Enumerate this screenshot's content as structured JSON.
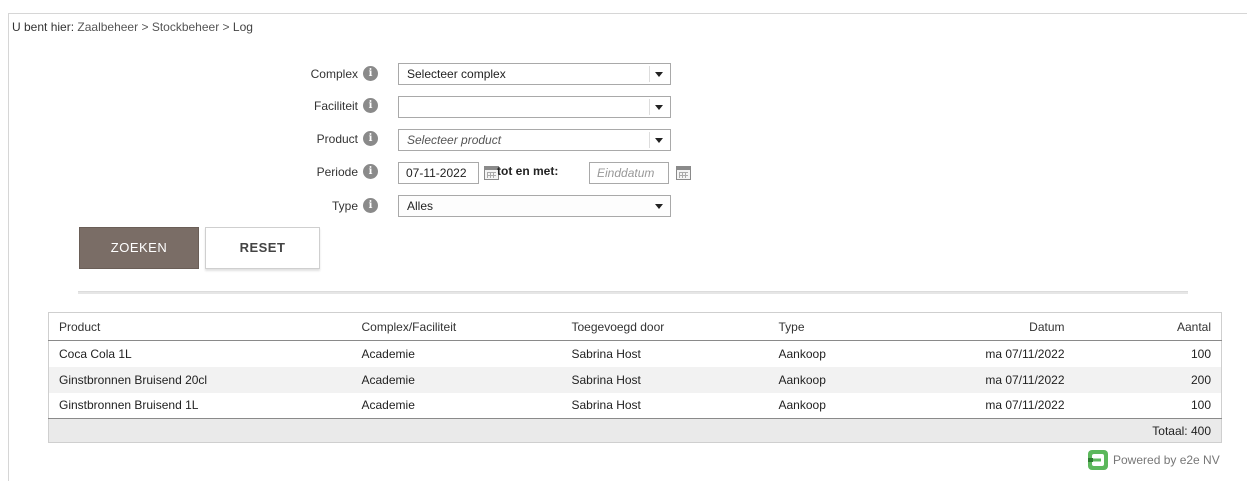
{
  "breadcrumb": {
    "prefix": "U bent hier:",
    "items": [
      "Zaalbeheer",
      "Stockbeheer",
      "Log"
    ],
    "separator": ">"
  },
  "filters": {
    "complex": {
      "label": "Complex",
      "value": "Selecteer complex"
    },
    "faciliteit": {
      "label": "Faciliteit",
      "value": ""
    },
    "product": {
      "label": "Product",
      "value": "Selecteer product"
    },
    "periode": {
      "label": "Periode",
      "start": "07-11-2022",
      "to_label": "tot en met:",
      "end_placeholder": "Einddatum"
    },
    "type": {
      "label": "Type",
      "value": "Alles"
    },
    "info_glyph": "i"
  },
  "buttons": {
    "search": "ZOEKEN",
    "reset": "RESET"
  },
  "table": {
    "headers": [
      "Product",
      "Complex/Faciliteit",
      "Toegevoegd door",
      "Type",
      "Datum",
      "Aantal"
    ],
    "rows": [
      [
        "Coca Cola 1L",
        "Academie",
        "Sabrina Host",
        "Aankoop",
        "ma 07/11/2022",
        "100"
      ],
      [
        "Ginstbronnen Bruisend 20cl",
        "Academie",
        "Sabrina Host",
        "Aankoop",
        "ma 07/11/2022",
        "200"
      ],
      [
        "Ginstbronnen Bruisend 1L",
        "Academie",
        "Sabrina Host",
        "Aankoop",
        "ma 07/11/2022",
        "100"
      ]
    ],
    "total": "Totaal: 400"
  },
  "footer": {
    "powered_by": "Powered by e2e NV"
  },
  "colors": {
    "search_button": "#7a6d66",
    "logo_green": "#5cb85c",
    "logo_dark": "#2e7d32"
  },
  "icons": {
    "info": "info-icon",
    "calendar": "calendar-icon",
    "dropdown": "chevron-down-icon",
    "logo": "e2e-logo-icon"
  }
}
